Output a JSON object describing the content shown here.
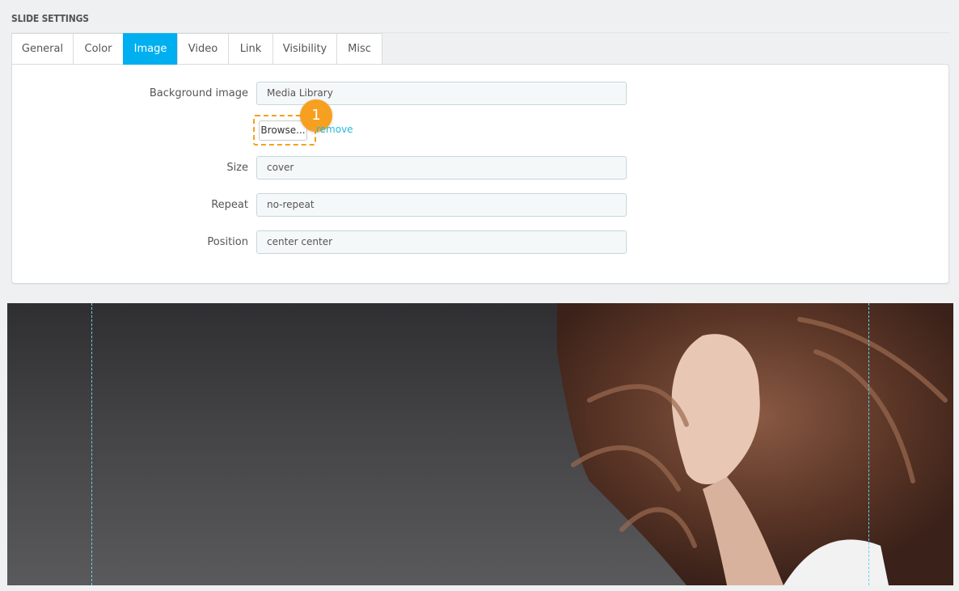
{
  "section": {
    "title": "SLIDE SETTINGS"
  },
  "tabs": [
    {
      "label": "General",
      "active": false
    },
    {
      "label": "Color",
      "active": false
    },
    {
      "label": "Image",
      "active": true
    },
    {
      "label": "Video",
      "active": false
    },
    {
      "label": "Link",
      "active": false
    },
    {
      "label": "Visibility",
      "active": false
    },
    {
      "label": "Misc",
      "active": false
    }
  ],
  "form": {
    "background_image": {
      "label": "Background image",
      "value": "Media Library"
    },
    "browse_label": "Browse...",
    "remove_label": "remove",
    "size": {
      "label": "Size",
      "value": "cover"
    },
    "repeat": {
      "label": "Repeat",
      "value": "no-repeat"
    },
    "position": {
      "label": "Position",
      "value": "center center"
    }
  },
  "callout": {
    "number": "1"
  },
  "colors": {
    "accent": "#00aff0",
    "callout": "#f7a01f",
    "link": "#25b9d7",
    "guide": "#63d5e6"
  }
}
